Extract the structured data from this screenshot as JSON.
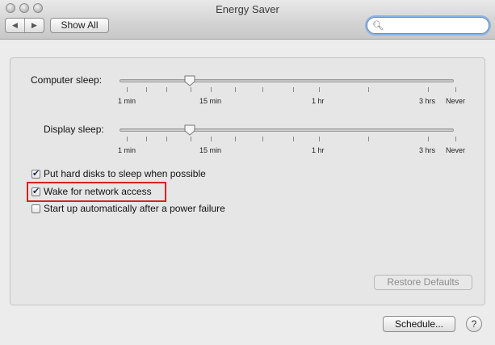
{
  "window": {
    "title": "Energy Saver"
  },
  "toolbar": {
    "back_icon": "◀",
    "forward_icon": "▶",
    "show_all_label": "Show All",
    "search_placeholder": "",
    "search_value": ""
  },
  "sleep": {
    "computer_label": "Computer sleep:",
    "display_label": "Display sleep:",
    "tick_labels": [
      "1 min",
      "15 min",
      "1 hr",
      "3 hrs",
      "Never"
    ],
    "computer_value": "15 min",
    "display_value": "15 min"
  },
  "options": [
    {
      "label": "Put hard disks to sleep when possible",
      "checked": true
    },
    {
      "label": "Wake for network access",
      "checked": true
    },
    {
      "label": "Start up automatically after a power failure",
      "checked": false
    }
  ],
  "buttons": {
    "restore_defaults": "Restore Defaults",
    "schedule": "Schedule...",
    "help": "?"
  },
  "colors": {
    "highlight": "#d42222",
    "search_focus": "#86b4ea"
  }
}
